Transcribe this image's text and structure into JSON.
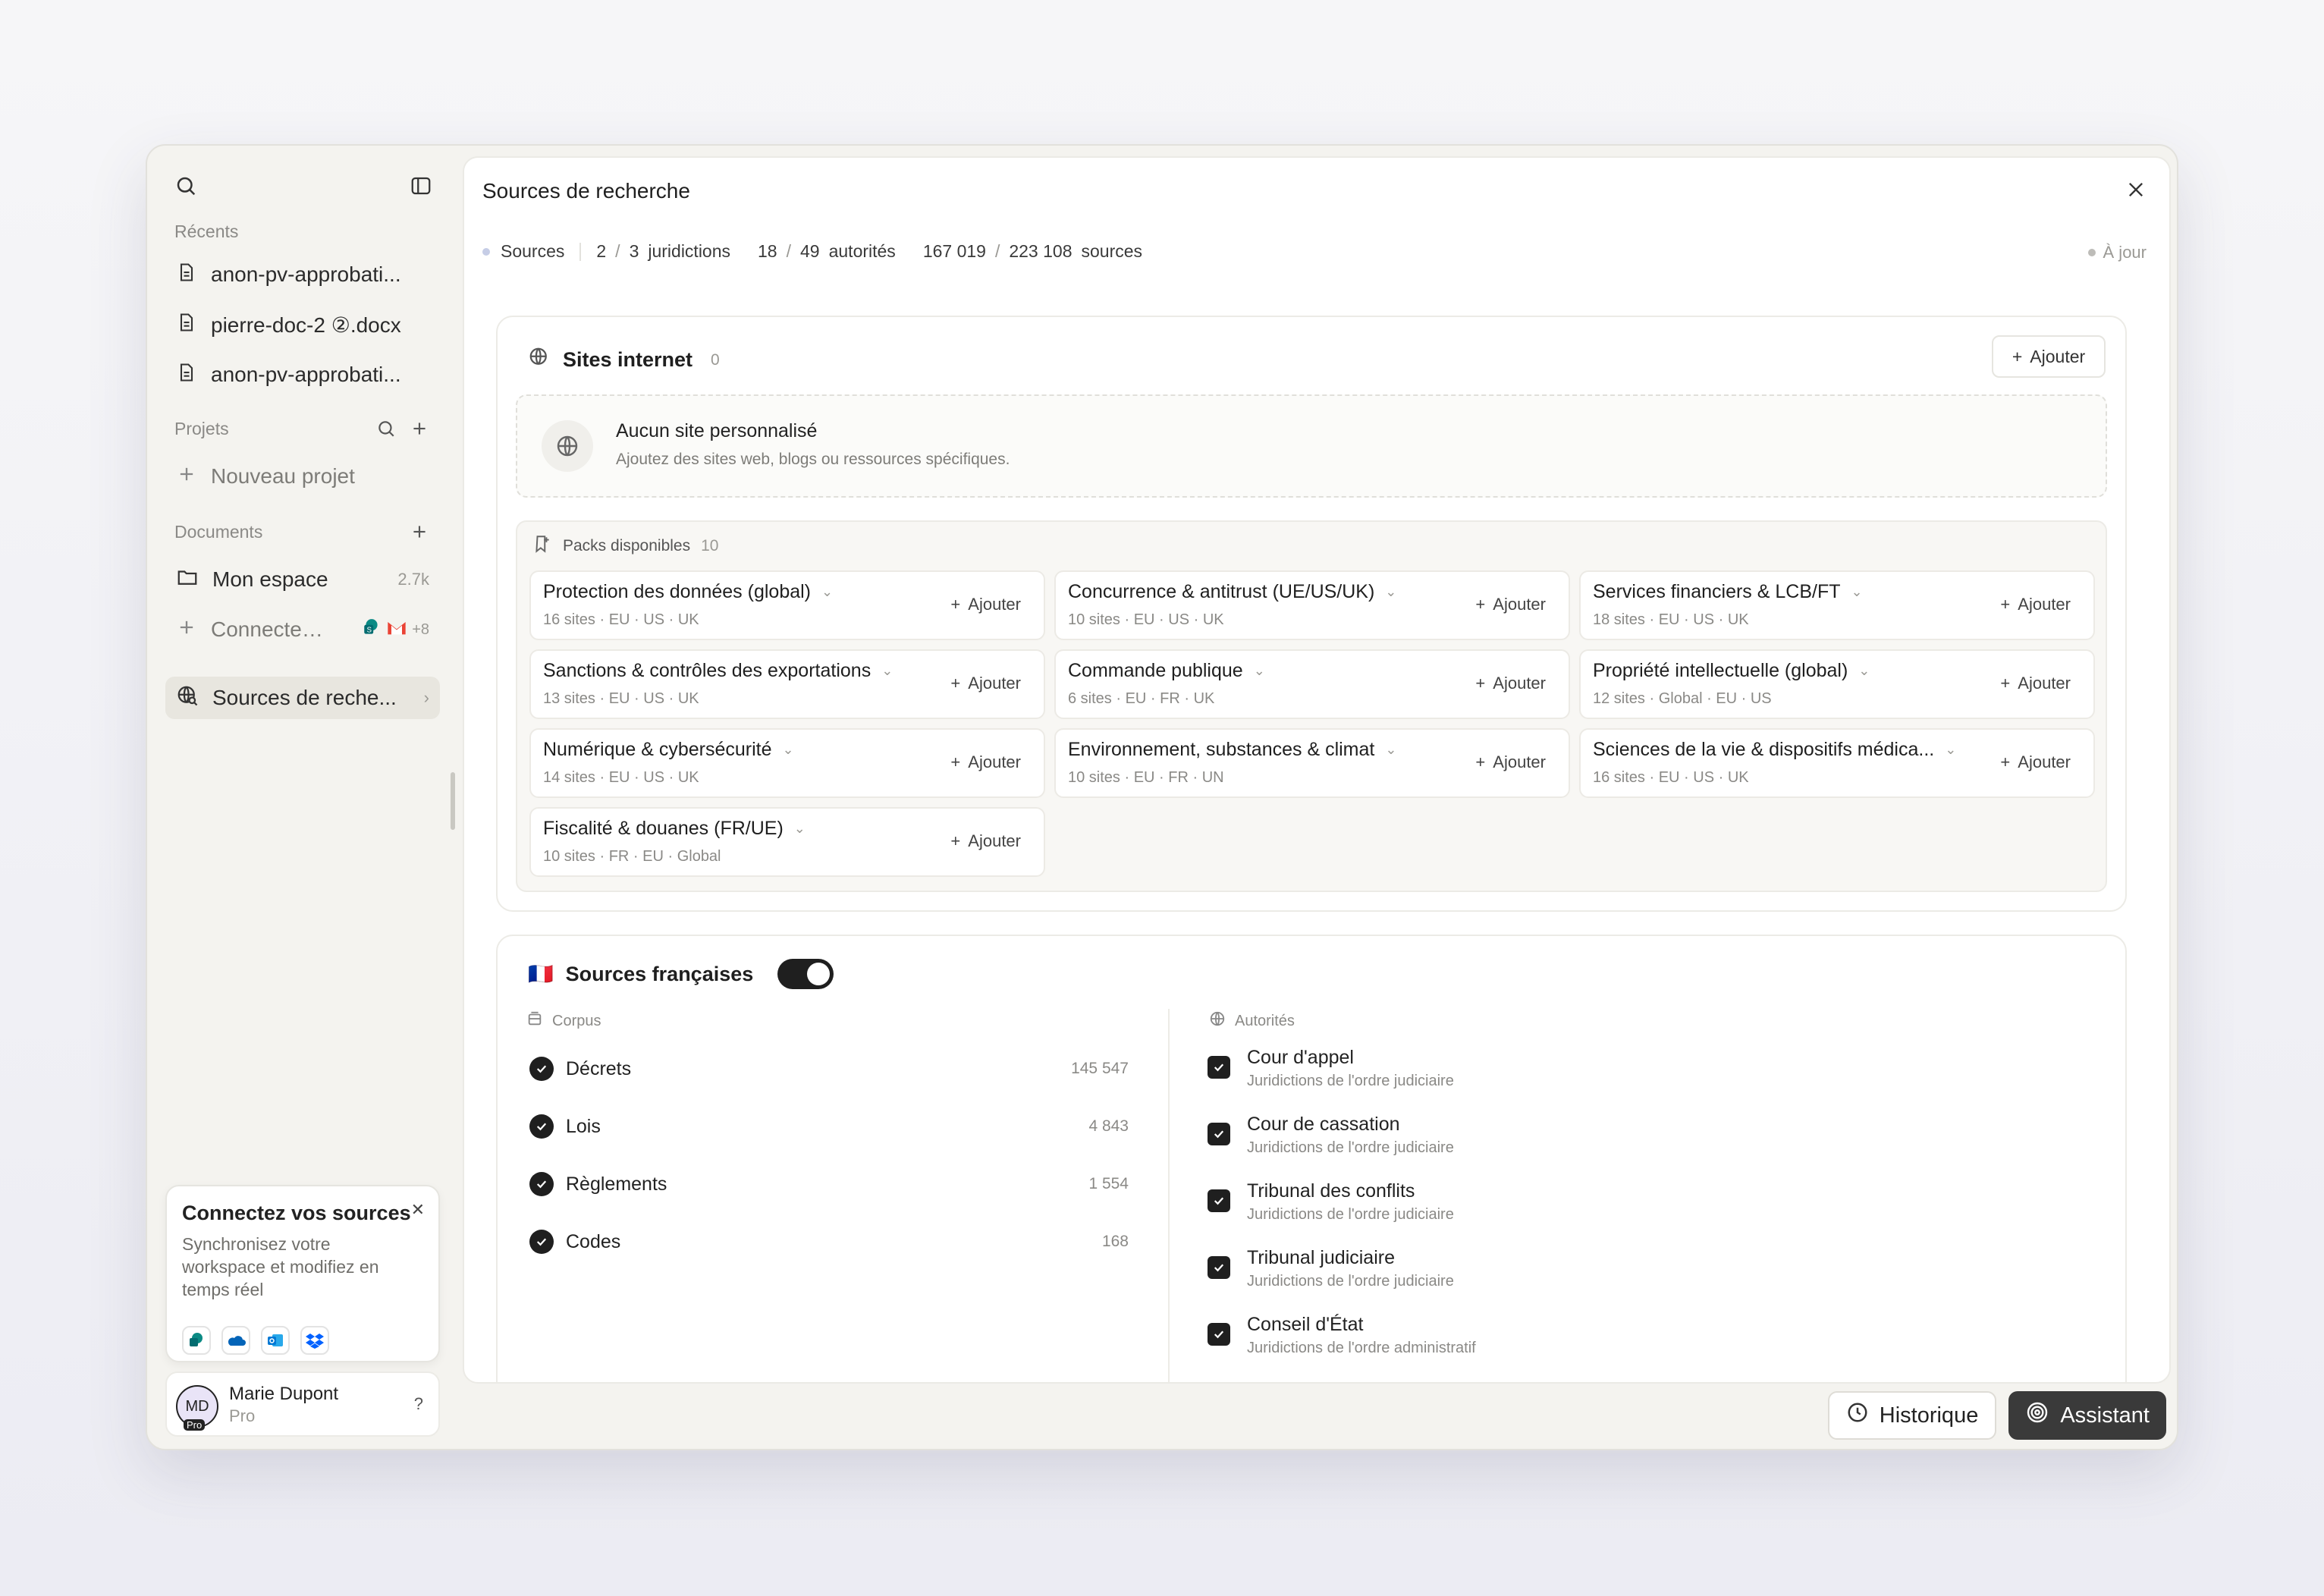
{
  "sidebar": {
    "recents_label": "Récents",
    "recents": [
      {
        "label": "anon-pv-approbati..."
      },
      {
        "label": "pierre-doc-2 ②.docx"
      },
      {
        "label": "anon-pv-approbati..."
      }
    ],
    "projects_label": "Projets",
    "new_project": "Nouveau projet",
    "documents_label": "Documents",
    "my_space": "Mon espace",
    "my_space_size": "2.7k",
    "connect": "Connecter ...",
    "connect_more": "+8",
    "research_sources": "Sources de reche...",
    "connect_card": {
      "title": "Connectez vos sources",
      "text": "Synchronisez votre workspace et modifiez en temps réel"
    },
    "user": {
      "initials": "MD",
      "badge": "Pro",
      "name": "Marie Dupont",
      "plan": "Pro",
      "help": "?"
    }
  },
  "main": {
    "title": "Sources de recherche",
    "stats": {
      "sources_label": "Sources",
      "jur_sel": "2",
      "jur_total": "3",
      "jur_label": "juridictions",
      "auth_sel": "18",
      "auth_total": "49",
      "auth_label": "autorités",
      "src_sel": "167 019",
      "src_total": "223 108",
      "src_label": "sources"
    },
    "status": "À jour",
    "websites": {
      "title": "Sites internet",
      "count": "0",
      "add": "Ajouter",
      "empty_title": "Aucun site personnalisé",
      "empty_sub": "Ajoutez des sites web, blogs ou ressources spécifiques."
    },
    "packs": {
      "title": "Packs disponibles",
      "count": "10",
      "add": "Ajouter",
      "items": [
        {
          "name": "Protection des données (global)",
          "meta": "16 sites · EU · US · UK"
        },
        {
          "name": "Concurrence & antitrust (UE/US/UK)",
          "meta": "10 sites · EU · US · UK"
        },
        {
          "name": "Services financiers & LCB/FT",
          "meta": "18 sites · EU · US · UK"
        },
        {
          "name": "Sanctions & contrôles des exportations",
          "meta": "13 sites · EU · US · UK"
        },
        {
          "name": "Commande publique",
          "meta": "6 sites · EU · FR · UK"
        },
        {
          "name": "Propriété intellectuelle (global)",
          "meta": "12 sites · Global · EU · US"
        },
        {
          "name": "Numérique & cybersécurité",
          "meta": "14 sites · EU · US · UK"
        },
        {
          "name": "Environnement, substances & climat",
          "meta": "10 sites · EU · FR · UN"
        },
        {
          "name": "Sciences de la vie & dispositifs médica...",
          "meta": "16 sites · EU · US · UK"
        },
        {
          "name": "Fiscalité & douanes (FR/UE)",
          "meta": "10 sites · FR · EU · Global"
        }
      ]
    },
    "french": {
      "flag": "🇫🇷",
      "title": "Sources françaises",
      "toggle_on": true,
      "corpus_label": "Corpus",
      "corpus": [
        {
          "name": "Décrets",
          "count": "145 547"
        },
        {
          "name": "Lois",
          "count": "4 843"
        },
        {
          "name": "Règlements",
          "count": "1 554"
        },
        {
          "name": "Codes",
          "count": "168"
        }
      ],
      "authorities_label": "Autorités",
      "authorities": [
        {
          "name": "Cour d'appel",
          "sub": "Juridictions de l'ordre judiciaire"
        },
        {
          "name": "Cour de cassation",
          "sub": "Juridictions de l'ordre judiciaire"
        },
        {
          "name": "Tribunal des conflits",
          "sub": "Juridictions de l'ordre judiciaire"
        },
        {
          "name": "Tribunal judiciaire",
          "sub": "Juridictions de l'ordre judiciaire"
        },
        {
          "name": "Conseil d'État",
          "sub": "Juridictions de l'ordre administratif"
        }
      ]
    }
  },
  "footer": {
    "history": "Historique",
    "assistant": "Assistant"
  }
}
